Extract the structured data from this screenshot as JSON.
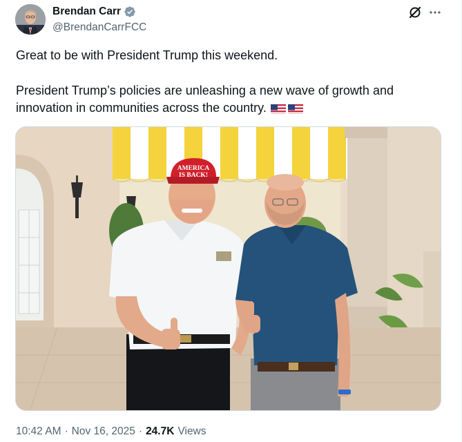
{
  "author": {
    "display_name": "Brendan Carr",
    "handle": "@BrendanCarrFCC",
    "verified": true,
    "verified_color": "#829aab"
  },
  "tweet": {
    "paragraph_1": "Great to be with President Trump this weekend.",
    "paragraph_2": "President Trump’s policies are unleashing a new wave of growth and innovation in communities across the country.",
    "emoji": [
      "us-flag-icon",
      "us-flag-icon"
    ]
  },
  "photo": {
    "hat_text_line1": "AMERICA",
    "hat_text_line2": "IS BACK!",
    "description": "two men giving thumbs up"
  },
  "meta": {
    "time": "10:42 AM",
    "date": "Nov 16, 2025",
    "separator": "·",
    "views_count": "24.7K",
    "views_label": "Views"
  },
  "icons": {
    "grok": "grok-icon",
    "more": "more-icon"
  },
  "colors": {
    "text_primary": "#0f1419",
    "text_secondary": "#536471",
    "hat_red": "#d0202b",
    "awning_yellow": "#f4d33c"
  }
}
